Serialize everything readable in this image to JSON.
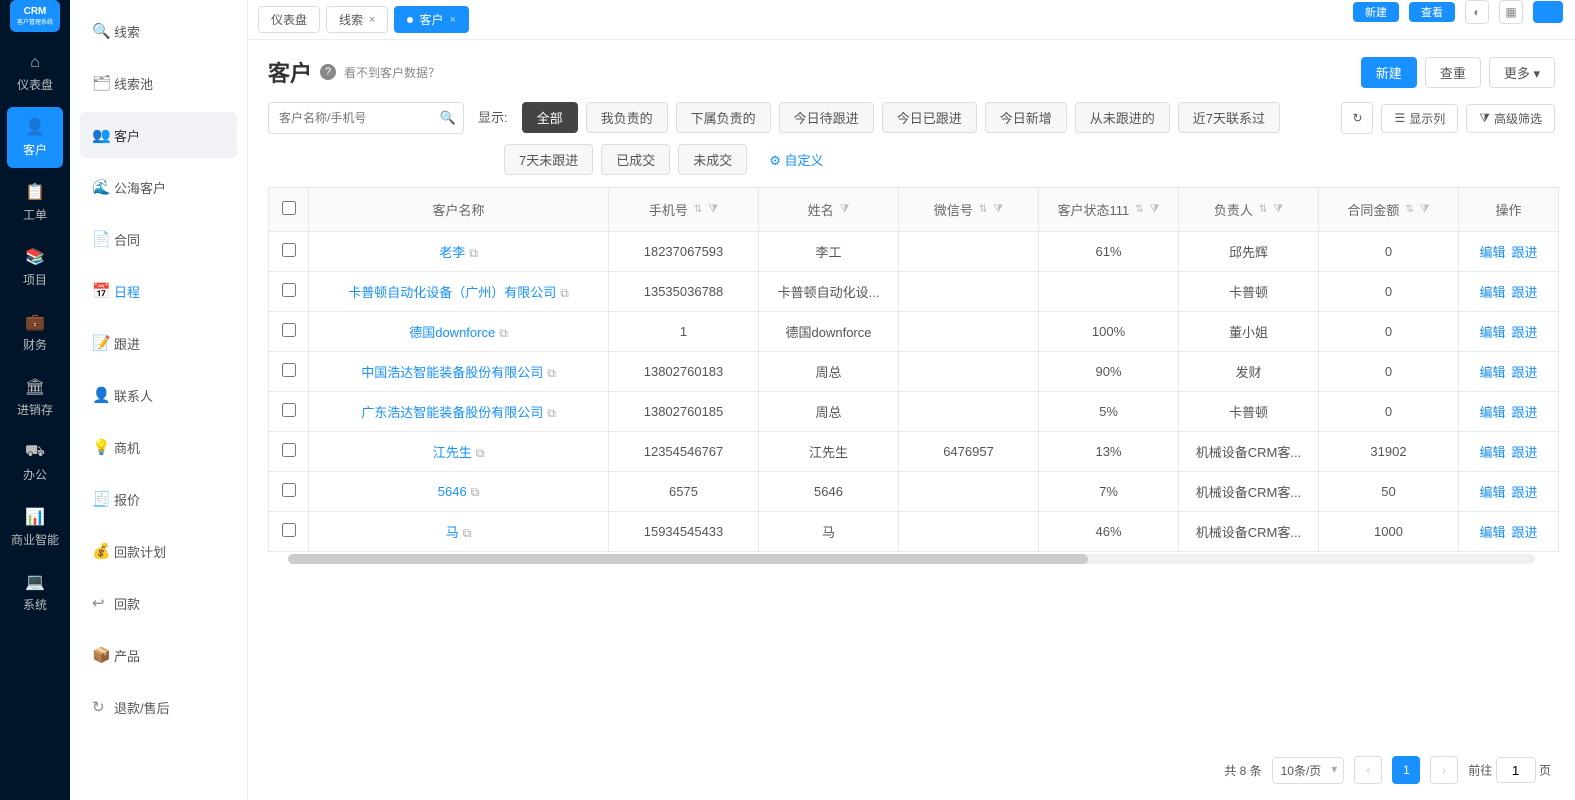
{
  "topbar": {
    "pill1": "新建",
    "pill2": "查看",
    "crm_text": "CRM"
  },
  "nav": {
    "logo_main": "CRM",
    "logo_sub": "客户管理系统",
    "items": [
      {
        "label": "仪表盘",
        "icon": "⌂"
      },
      {
        "label": "客户",
        "icon": "👤",
        "active": true
      },
      {
        "label": "工单",
        "icon": "📋"
      },
      {
        "label": "项目",
        "icon": "📚"
      },
      {
        "label": "财务",
        "icon": "💼"
      },
      {
        "label": "进销存",
        "icon": "🏛"
      },
      {
        "label": "办公",
        "icon": "⛟"
      },
      {
        "label": "商业智能",
        "icon": "📊"
      },
      {
        "label": "系统",
        "icon": "💻"
      }
    ]
  },
  "sidebar": {
    "items": [
      {
        "icon": "🔍",
        "label": "线索"
      },
      {
        "icon": "🗂",
        "label": "线索池"
      },
      {
        "icon": "👥",
        "label": "客户",
        "active": true
      },
      {
        "icon": "🌊",
        "label": "公海客户"
      },
      {
        "icon": "📄",
        "label": "合同"
      },
      {
        "icon": "📅",
        "label": "日程",
        "selected": true
      },
      {
        "icon": "📝",
        "label": "跟进"
      },
      {
        "icon": "👤",
        "label": "联系人"
      },
      {
        "icon": "💡",
        "label": "商机"
      },
      {
        "icon": "🧾",
        "label": "报价"
      },
      {
        "icon": "💰",
        "label": "回款计划"
      },
      {
        "icon": "↩",
        "label": "回款"
      },
      {
        "icon": "📦",
        "label": "产品"
      },
      {
        "icon": "↻",
        "label": "退款/售后"
      }
    ]
  },
  "tabs": [
    {
      "label": "仪表盘"
    },
    {
      "label": "线索",
      "closable": true
    },
    {
      "label": "客户",
      "active": true,
      "dot": true,
      "closable": true
    }
  ],
  "header": {
    "title": "客户",
    "help": "看不到客户数据？",
    "new_btn": "新建",
    "reset_btn": "查重",
    "more_btn": "更多"
  },
  "filter": {
    "search_placeholder": "客户名称/手机号",
    "show_label": "显示:",
    "chips1": [
      "全部",
      "我负责的",
      "下属负责的",
      "今日待跟进",
      "今日已跟进",
      "今日新增",
      "从未跟进的",
      "近7天联系过"
    ],
    "chips2": [
      "7天未跟进",
      "已成交",
      "未成交"
    ],
    "custom_label": "自定义",
    "col_btn": "显示列",
    "adv_btn": "高级筛选"
  },
  "table": {
    "columns": [
      "客户名称",
      "手机号",
      "姓名",
      "微信号",
      "客户状态111",
      "负责人",
      "合同金额",
      "操作"
    ],
    "edit_label": "编辑",
    "follow_label": "跟进",
    "rows": [
      {
        "name": "老李",
        "copy": true,
        "phone": "18237067593",
        "xm": "李工",
        "wx": "",
        "status": "61%",
        "owner": "邱先辉",
        "amount": "0"
      },
      {
        "name": "卡普顿自动化设备（广州）有限公司",
        "copy": true,
        "phone": "13535036788",
        "xm": "卡普顿自动化设...",
        "wx": "",
        "status": "",
        "owner": "卡普顿",
        "amount": "0"
      },
      {
        "name": "德国downforce",
        "copy": true,
        "phone": "1",
        "xm": "德国downforce",
        "wx": "",
        "status": "100%",
        "owner": "董小姐",
        "amount": "0"
      },
      {
        "name": "中国浩达智能装备股份有限公司",
        "copy": true,
        "phone": "13802760183",
        "xm": "周总",
        "wx": "",
        "status": "90%",
        "owner": "发财",
        "amount": "0"
      },
      {
        "name": "广东浩达智能装备股份有限公司",
        "copy": true,
        "phone": "13802760185",
        "xm": "周总",
        "wx": "",
        "status": "5%",
        "owner": "卡普顿",
        "amount": "0"
      },
      {
        "name": "江先生",
        "copy": true,
        "phone": "12354546767",
        "xm": "江先生",
        "wx": "6476957",
        "status": "13%",
        "owner": "机械设备CRM客...",
        "amount": "31902"
      },
      {
        "name": "5646",
        "copy": true,
        "phone": "6575",
        "xm": "5646",
        "wx": "",
        "status": "7%",
        "owner": "机械设备CRM客...",
        "amount": "50"
      },
      {
        "name": "马",
        "copy": true,
        "phone": "15934545433",
        "xm": "马",
        "wx": "",
        "status": "46%",
        "owner": "机械设备CRM客...",
        "amount": "1000"
      }
    ]
  },
  "pagination": {
    "total_label": "共 8 条",
    "page_size": "10条/页",
    "current": "1",
    "jump_prefix": "前往",
    "jump_value": "1",
    "jump_suffix": "页"
  }
}
